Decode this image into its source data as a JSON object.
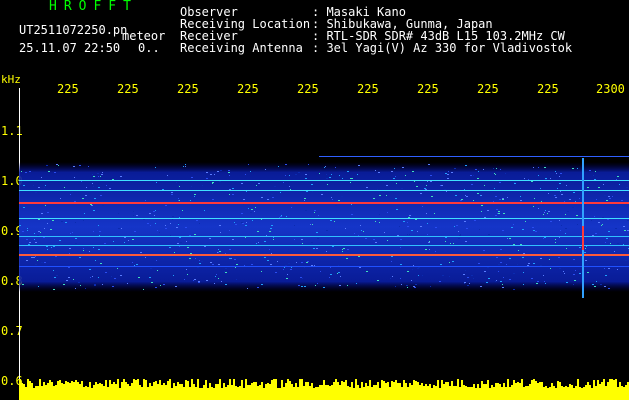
{
  "header": {
    "logo": "HROFFT",
    "file_name": "UT2511072250.pn",
    "mode": "meteor",
    "date_time": "25.11.07 22:50",
    "count": "0..",
    "meta": [
      {
        "label": "Observer",
        "value": ": Masaki Kano"
      },
      {
        "label": "Receiving Location",
        "value": ": Shibukawa, Gunma, Japan"
      },
      {
        "label": "Receiver",
        "value": ": RTL-SDR SDR# 43dB L15 103.2MHz CW"
      },
      {
        "label": "Receiving Antenna",
        "value": ": 3el Yagi(V) Az 330 for Vladivostok"
      }
    ]
  },
  "axis": {
    "unit": "kHz",
    "x_ticks": [
      "225",
      "225",
      "225",
      "225",
      "225",
      "225",
      "225",
      "225",
      "225",
      "2300"
    ],
    "y_ticks": [
      "1.1",
      "1.0",
      "0.9",
      "0.8",
      "0.7",
      "0.6"
    ]
  },
  "colors": {
    "background": "#000000",
    "axis_text": "#ffff00",
    "header_text": "#ffffff",
    "logo": "#00ff00",
    "noise_floor": "#ffff00"
  }
}
